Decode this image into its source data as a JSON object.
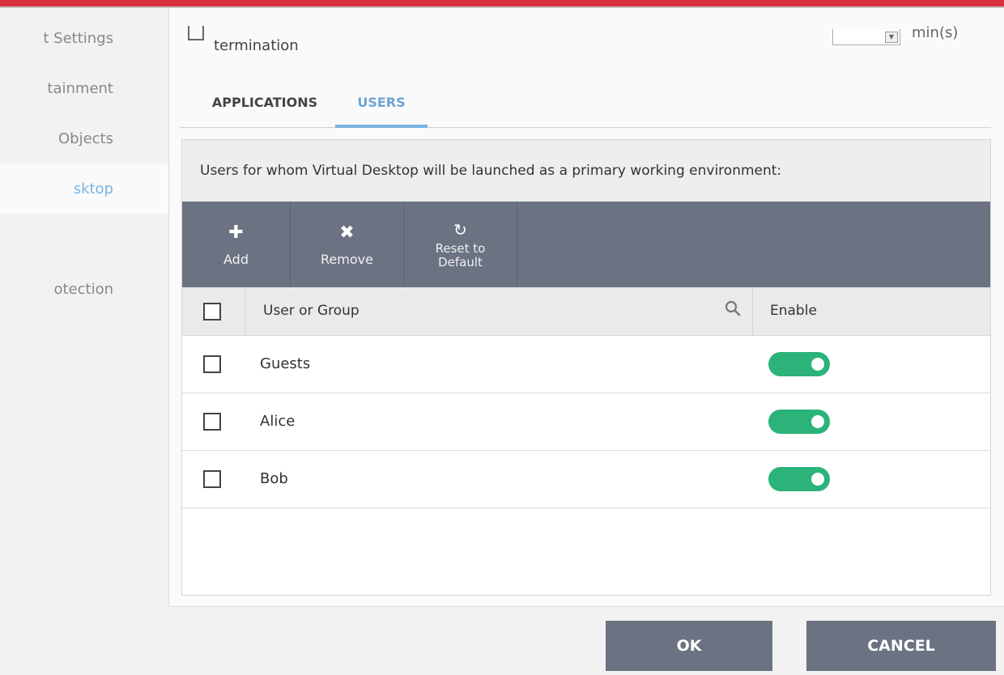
{
  "sidebar": {
    "items": [
      {
        "label": "t Settings"
      },
      {
        "label": "tainment"
      },
      {
        "label": "Objects"
      },
      {
        "label": "sktop"
      },
      {
        "label": "otection"
      }
    ]
  },
  "options": {
    "termination_label": "termination",
    "spin_unit": "min(s)"
  },
  "tabs": {
    "applications": "APPLICATIONS",
    "users": "USERS"
  },
  "users_panel": {
    "description": "Users for whom Virtual Desktop will be launched as a primary working environment:",
    "toolbar": {
      "add": "Add",
      "remove": "Remove",
      "reset": "Reset to Default"
    },
    "table": {
      "col_user": "User or Group",
      "col_enable": "Enable",
      "rows": [
        {
          "name": "Guests",
          "enabled": true
        },
        {
          "name": "Alice",
          "enabled": true
        },
        {
          "name": "Bob",
          "enabled": true
        }
      ]
    }
  },
  "footer": {
    "ok": "OK",
    "cancel": "CANCEL"
  },
  "colors": {
    "accent": "#7ab3de",
    "toolbar": "#6b7282",
    "toggle_on": "#2bb37a",
    "top_strip": "#d63040"
  }
}
